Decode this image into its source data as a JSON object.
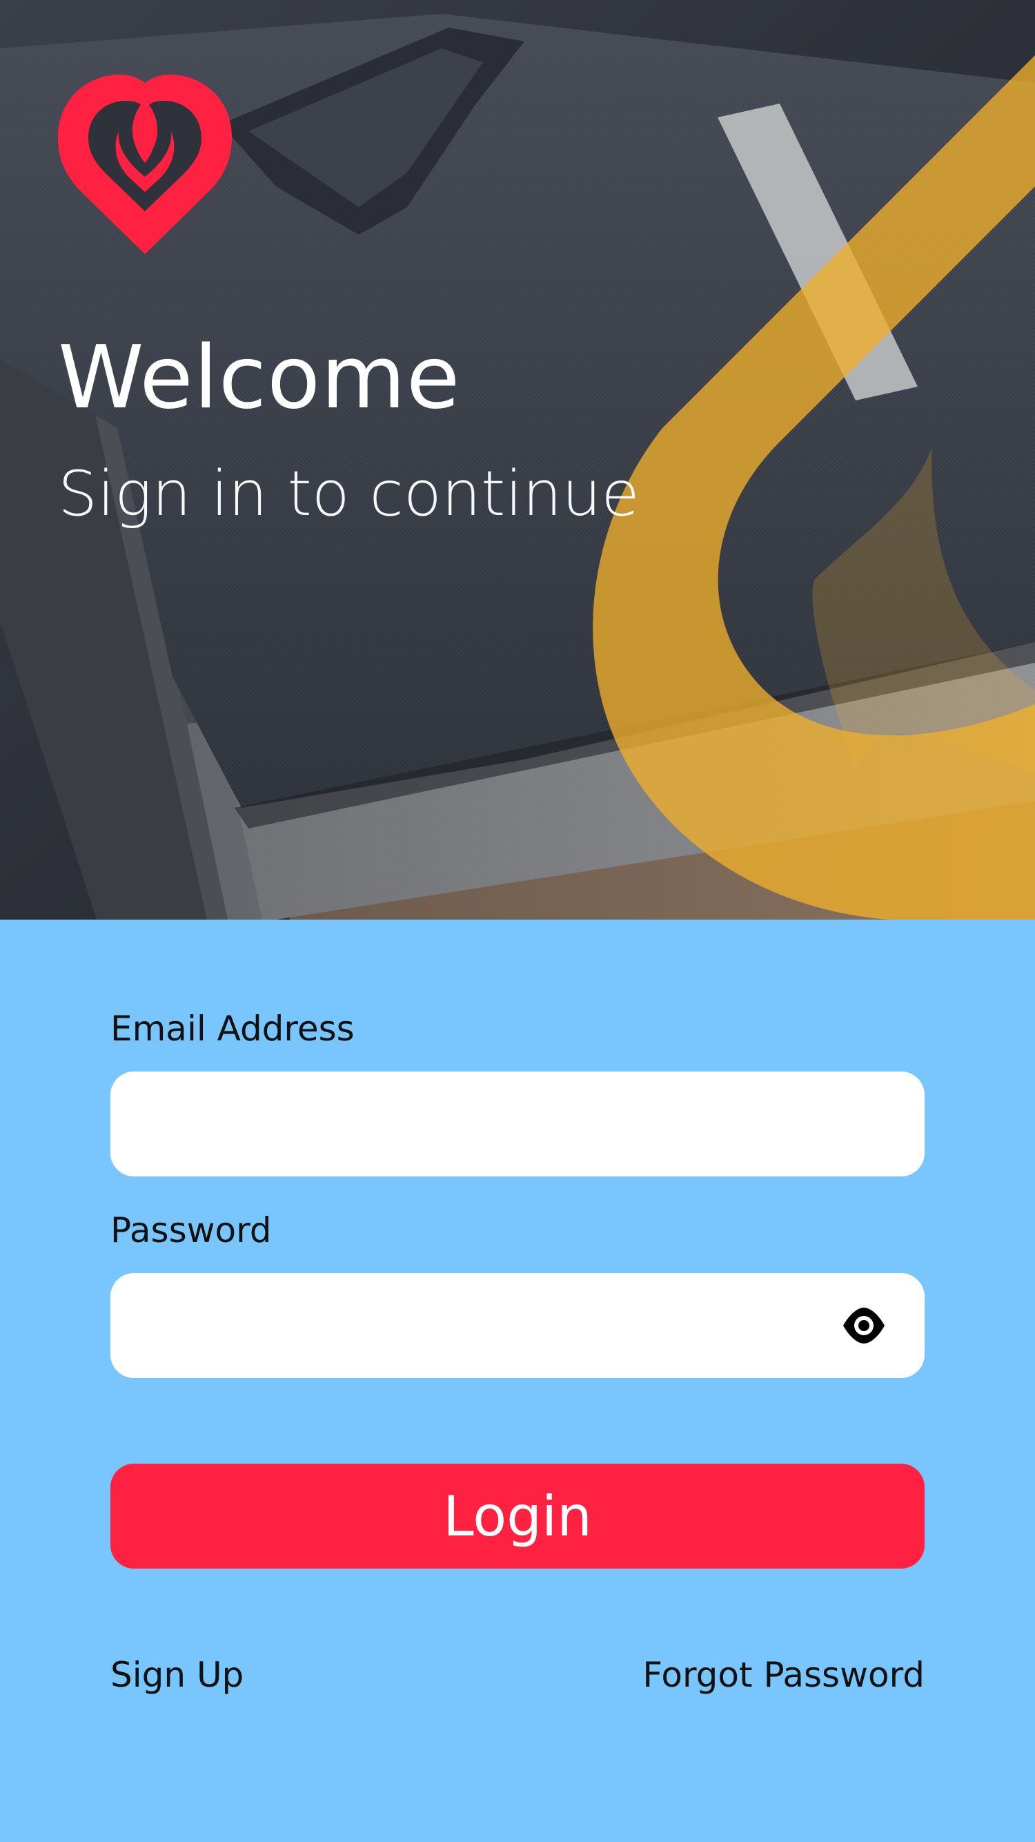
{
  "hero": {
    "title": "Welcome",
    "subtitle": "Sign in to continue",
    "logo_icon": "heart-flame-logo",
    "background_image": "folded-sweaters-photo"
  },
  "form": {
    "email_label": "Email Address",
    "email_value": "",
    "email_placeholder": "",
    "password_label": "Password",
    "password_value": "",
    "password_placeholder": "",
    "password_toggle_icon": "eye-icon",
    "login_label": "Login",
    "signup_label": "Sign Up",
    "forgot_label": "Forgot Password"
  },
  "colors": {
    "accent_red": "#ff2142",
    "form_background": "#78c6fd",
    "overlay_yellow": "#f0b02c",
    "input_background": "#ffffff",
    "text_dark": "#111111"
  }
}
